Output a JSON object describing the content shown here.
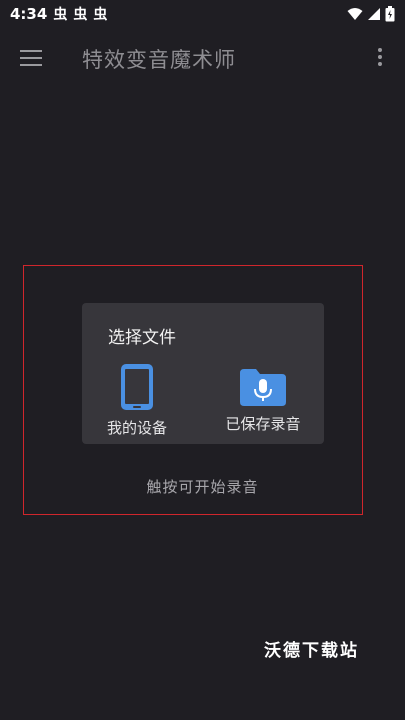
{
  "status_bar": {
    "time": "4:34",
    "notification_icons": [
      "bug-icon",
      "bug-icon",
      "bug-icon"
    ],
    "status_glyph": "虫"
  },
  "app_bar": {
    "title": "特效变音魔术师"
  },
  "dialog": {
    "title": "选择文件",
    "options": [
      {
        "label": "我的设备",
        "icon": "phone-icon",
        "color": "#4a90e2"
      },
      {
        "label": "已保存录音",
        "icon": "folder-mic-icon",
        "color": "#4a90e2"
      }
    ]
  },
  "hint": "触按可开始录音",
  "watermark": "沃德下载站",
  "colors": {
    "background": "#1f1e23",
    "dialog": "#37363b",
    "accent": "#4a90e2",
    "highlight": "#d0262c"
  }
}
